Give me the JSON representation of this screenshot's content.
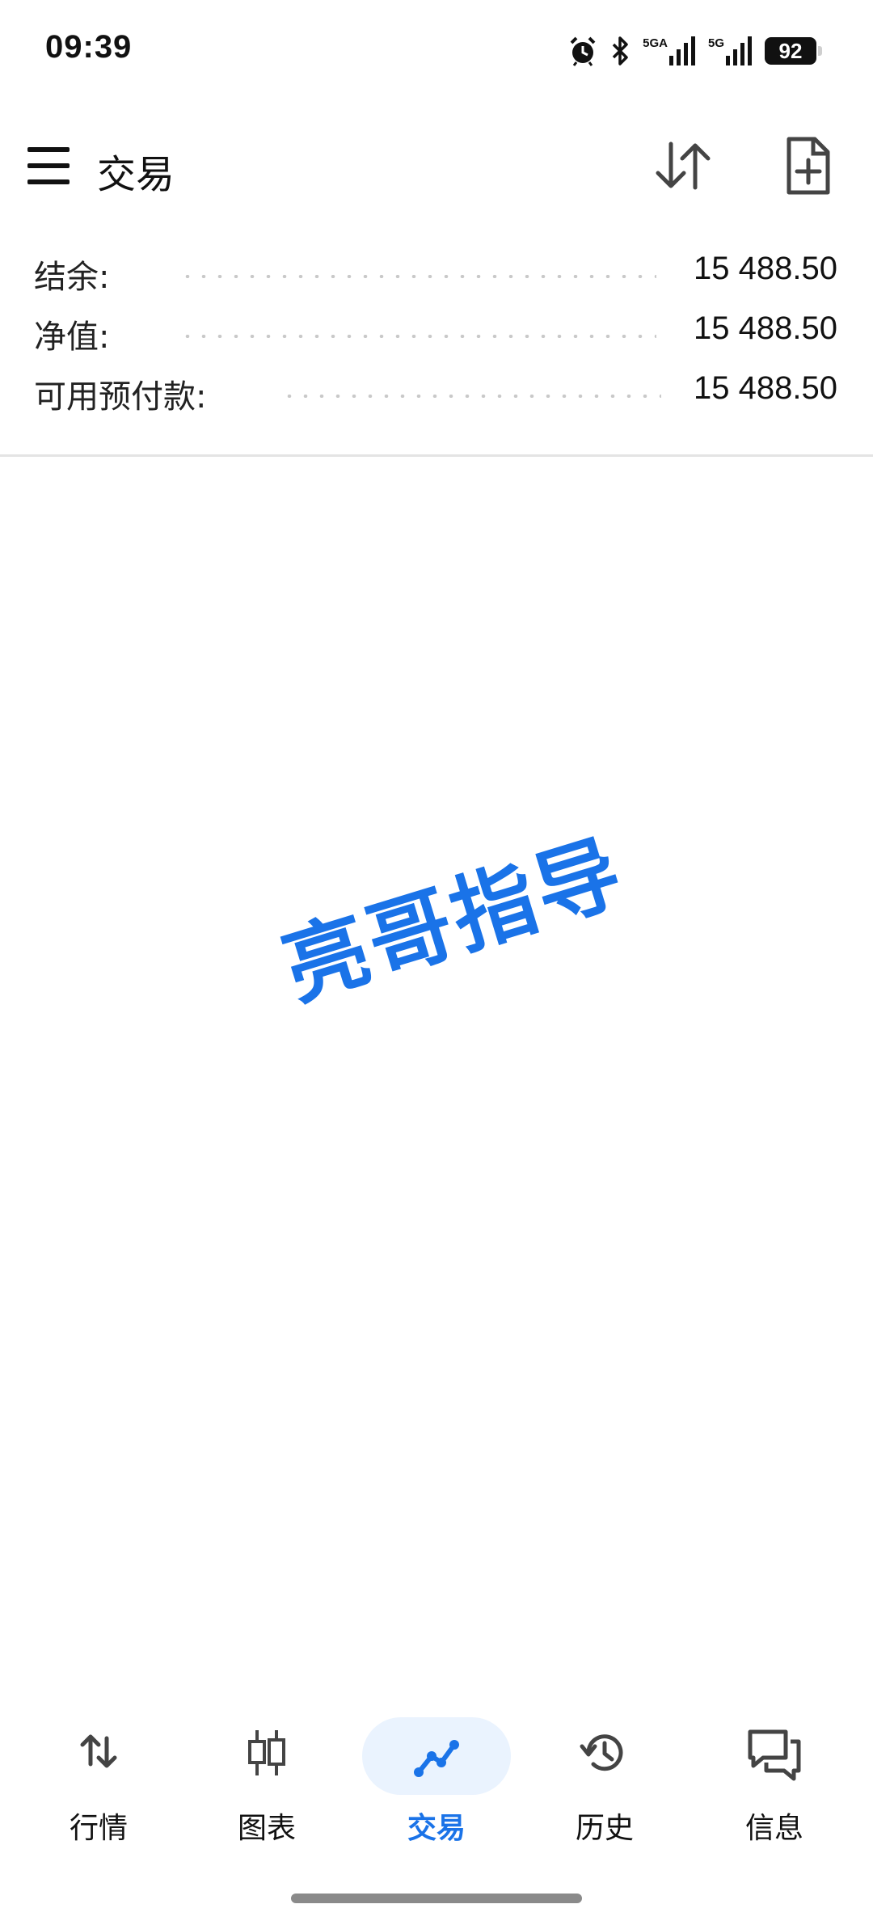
{
  "status_bar": {
    "time": "09:39",
    "network_1": "5GA",
    "network_2": "5G",
    "battery": "92",
    "icons": [
      "alarm-icon",
      "bluetooth-icon",
      "signal-icon",
      "signal-icon",
      "battery-icon"
    ]
  },
  "app_bar": {
    "title": "交易",
    "icons": [
      "menu-icon",
      "sort-icon",
      "new-document-icon"
    ]
  },
  "summary": {
    "rows": [
      {
        "label": "结余:",
        "value": "15 488.50"
      },
      {
        "label": "净值:",
        "value": "15 488.50"
      },
      {
        "label": "可用预付款:",
        "value": "15 488.50"
      }
    ]
  },
  "watermark": {
    "text": "亮哥指导",
    "color": "#1a73e8"
  },
  "bottom_nav": {
    "items": [
      {
        "label": "行情",
        "icon": "quotes-arrows-icon",
        "active": false
      },
      {
        "label": "图表",
        "icon": "candlestick-chart-icon",
        "active": false
      },
      {
        "label": "交易",
        "icon": "trade-line-icon",
        "active": true
      },
      {
        "label": "历史",
        "icon": "history-icon",
        "active": false
      },
      {
        "label": "信息",
        "icon": "messages-icon",
        "active": false
      }
    ],
    "accent_color": "#1a73e8"
  }
}
